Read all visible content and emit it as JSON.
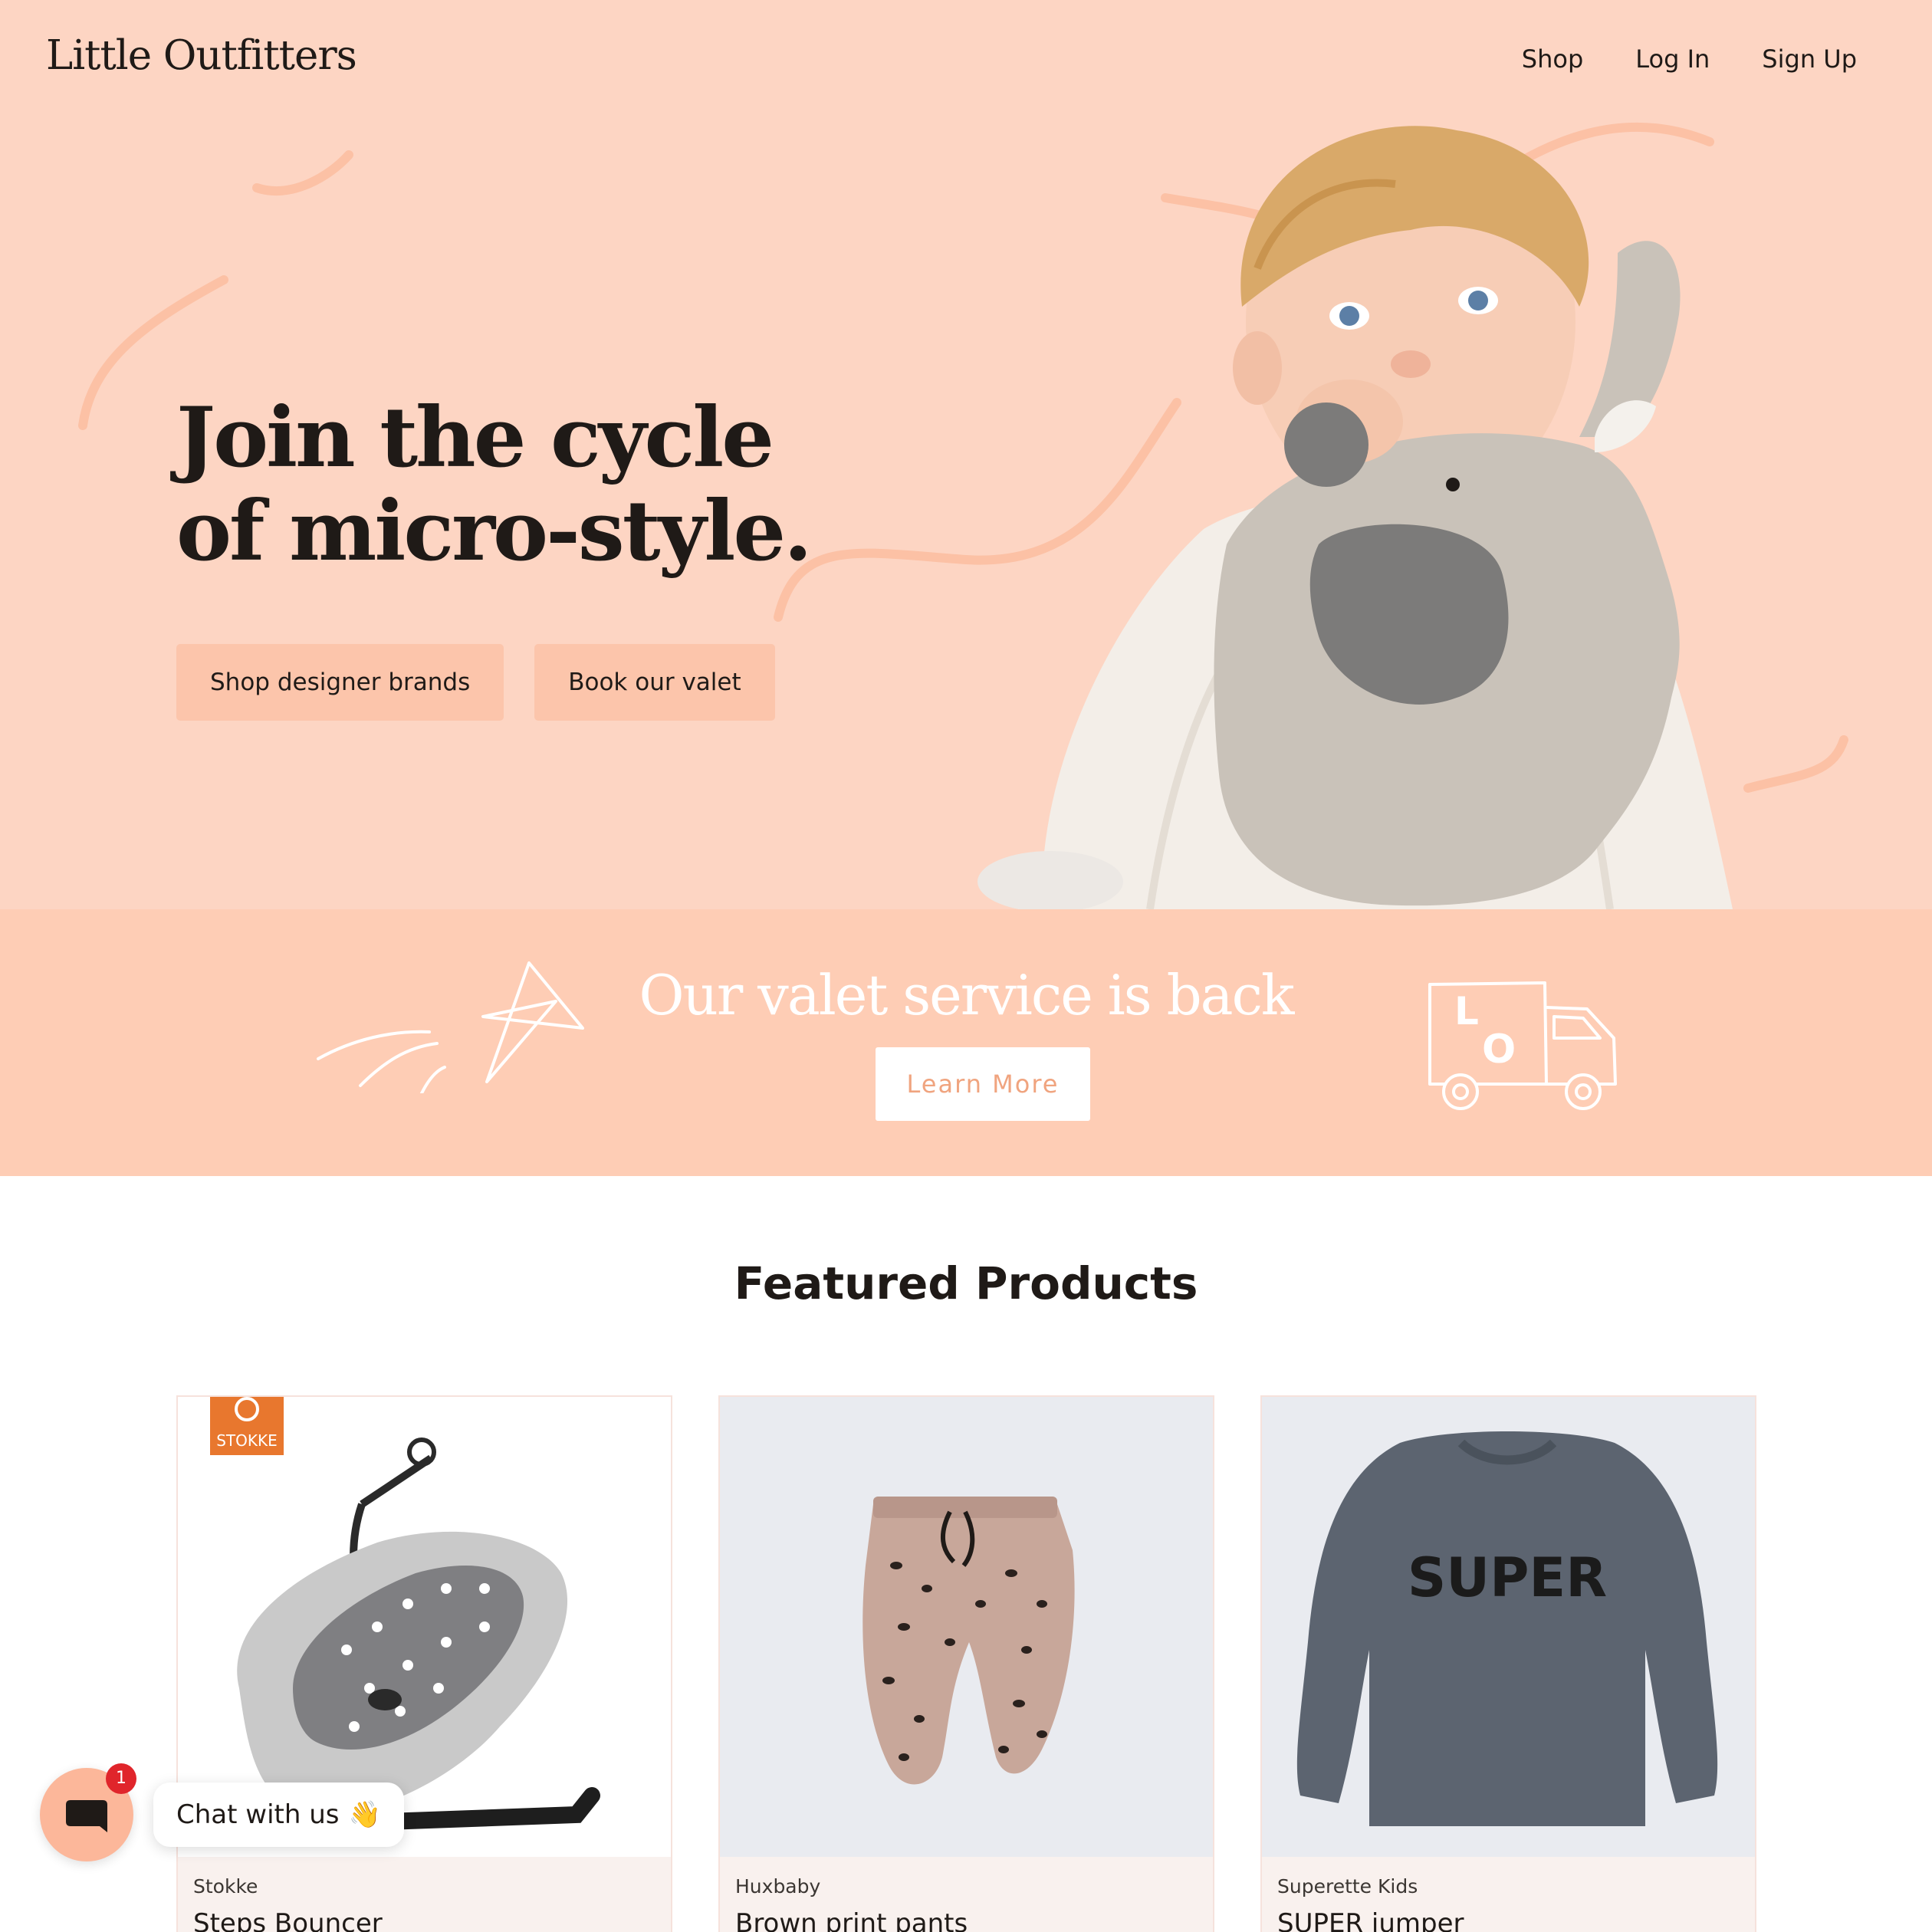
{
  "header": {
    "logo": "Little Outfitters",
    "nav": [
      "Shop",
      "Log In",
      "Sign Up"
    ]
  },
  "hero": {
    "headline_line1": "Join the cycle",
    "headline_line2": "of micro-style.",
    "cta_primary": "Shop designer brands",
    "cta_secondary": "Book our valet"
  },
  "valet": {
    "title": "Our valet service is back",
    "button": "Learn More",
    "truck_letters": [
      "L",
      "O"
    ]
  },
  "featured": {
    "title": "Featured Products",
    "products": [
      {
        "brand": "Stokke",
        "name": "Steps Bouncer",
        "logo_text": "STOKKE"
      },
      {
        "brand": "Huxbaby",
        "name": "Brown print pants"
      },
      {
        "brand": "Superette Kids",
        "name": "SUPER jumper",
        "print_text": "SUPER"
      }
    ]
  },
  "chat": {
    "label": "Chat with us",
    "badge": "1",
    "emoji": "👋"
  },
  "colors": {
    "hero_bg": "#fdd5c3",
    "banner_bg": "#fecdb5",
    "button_bg": "#fcc5ab",
    "accent_text": "#f0a47f",
    "badge": "#e0252b"
  }
}
